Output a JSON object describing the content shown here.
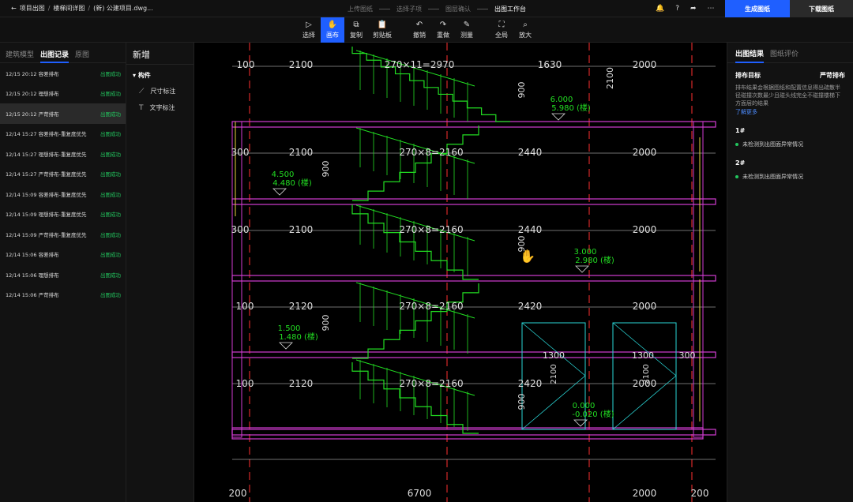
{
  "breadcrumb": {
    "back_label": "项目出图",
    "item2": "楼梯间详图",
    "item3": "(新) 公建项目.dwg..."
  },
  "steps": [
    "上传图纸",
    "选择子项",
    "图层确认",
    "出图工作台"
  ],
  "actions": {
    "generate": "生成图纸",
    "download": "下载图纸"
  },
  "toolbar": [
    {
      "icon": "▷",
      "label": "选择",
      "name": "select"
    },
    {
      "icon": "✋",
      "label": "画布",
      "name": "canvas"
    },
    {
      "icon": "⧉",
      "label": "复制",
      "name": "copy"
    },
    {
      "icon": "📋",
      "label": "剪贴板",
      "name": "clipboard"
    },
    {
      "icon": "↶",
      "label": "撤销",
      "name": "undo"
    },
    {
      "icon": "↷",
      "label": "重做",
      "name": "redo"
    },
    {
      "icon": "✎",
      "label": "测量",
      "name": "measure"
    },
    {
      "icon": "⛶",
      "label": "全局",
      "name": "fit-all"
    },
    {
      "icon": "⌕",
      "label": "放大",
      "name": "zoom-in"
    }
  ],
  "left_tabs": [
    "建筑模型",
    "出图记录",
    "原图"
  ],
  "records": [
    {
      "time": "12/15 20:12",
      "name": "容差排布",
      "status": "出图成功"
    },
    {
      "time": "12/15 20:12",
      "name": "理想排布",
      "status": "出图成功"
    },
    {
      "time": "12/15 20:12",
      "name": "严苛排布",
      "status": "出图成功"
    },
    {
      "time": "12/14 15:27",
      "name": "容差排布-重复度优先",
      "status": "出图成功"
    },
    {
      "time": "12/14 15:27",
      "name": "理想排布-重复度优先",
      "status": "出图成功"
    },
    {
      "time": "12/14 15:27",
      "name": "严苛排布-重复度优先",
      "status": "出图成功"
    },
    {
      "time": "12/14 15:09",
      "name": "容差排布-重复度优先",
      "status": "出图成功"
    },
    {
      "time": "12/14 15:09",
      "name": "理想排布-重复度优先",
      "status": "出图成功"
    },
    {
      "time": "12/14 15:09",
      "name": "严苛排布-重复度优先",
      "status": "出图成功"
    },
    {
      "time": "12/14 15:06",
      "name": "容差排布",
      "status": "出图成功"
    },
    {
      "time": "12/14 15:06",
      "name": "理想排布",
      "status": "出图成功"
    },
    {
      "time": "12/14 15:06",
      "name": "严苛排布",
      "status": "出图成功"
    }
  ],
  "mid_panel": {
    "title": "新增",
    "group": "构件",
    "items": [
      "尺寸标注",
      "文字标注"
    ]
  },
  "right_tabs": [
    "出图结果",
    "图纸评价"
  ],
  "result": {
    "target_label": "排布目标",
    "target_value": "严苛排布",
    "desc": "排布结果会根据图纸和配置信息得出疏散半径碰撞次数最少且碰头线完全不碰撞楼梯下方面层的结果",
    "link": "了解更多",
    "sections": [
      {
        "title": "1#",
        "note": "未检测到出图面异常情况"
      },
      {
        "title": "2#",
        "note": "未检测到出图面异常情况"
      }
    ]
  },
  "drawing": {
    "top_dims": [
      "100",
      "2100",
      "270×11=2970",
      "1630",
      "2000",
      "2100"
    ],
    "row1": [
      "300",
      "2100",
      "270×8=2160",
      "2440",
      "2000"
    ],
    "row2": [
      "300",
      "2100",
      "270×8=2160",
      "2440",
      "2000"
    ],
    "row3": [
      "100",
      "2120",
      "270×8=2160",
      "2420",
      "2000"
    ],
    "row4": [
      "100",
      "2120",
      "270×8=2160",
      "2420",
      "2000"
    ],
    "door_dims": [
      "1300",
      "1300",
      "300",
      "2100",
      "2100"
    ],
    "bottom_dims": [
      "200",
      "6700",
      "2000",
      "200"
    ],
    "verticals": [
      "900",
      "900",
      "900",
      "900",
      "900"
    ],
    "levels": [
      {
        "a": "6.000",
        "b": "5.980 (楼)"
      },
      {
        "a": "4.500",
        "b": "4.480 (楼)"
      },
      {
        "a": "3.000",
        "b": "2.980 (楼)"
      },
      {
        "a": "1.500",
        "b": "1.480 (楼)"
      },
      {
        "a": "0.000",
        "b": "-0.020 (楼)"
      }
    ],
    "colors": {
      "green": "#22dd22",
      "magenta": "#d23cd2",
      "cyan": "#2ad6d6",
      "red": "#ff3030",
      "yellow": "#e6d23c",
      "white": "#dddddd"
    }
  }
}
